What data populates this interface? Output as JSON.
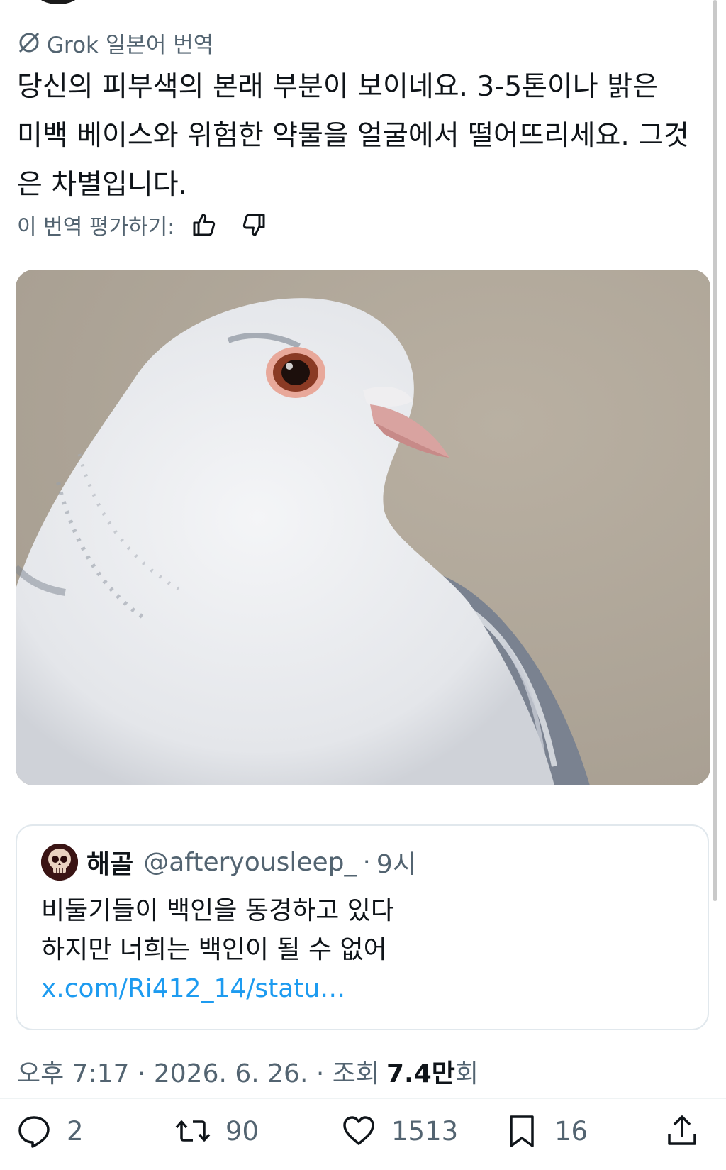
{
  "grok": {
    "label": "Grok 일본어 번역",
    "icon": "grok-logo-icon"
  },
  "tweet": {
    "translated_text": "당신의 피부색의 본래 부분이 보이네요. 3-5톤이나 밝은 미백 베이스와 위험한 약물을 얼굴에서 떨어뜨리세요. 그것은 차별입니다."
  },
  "rating": {
    "label": "이 번역 평가하기:",
    "up_icon": "thumbs-up-icon",
    "down_icon": "thumbs-down-icon"
  },
  "media": {
    "icon": "white-pigeon-photo"
  },
  "quote": {
    "avatar_icon": "skull-avatar-icon",
    "name": "해골",
    "handle": "@afteryousleep_",
    "separator": "·",
    "time": "9시",
    "line1": "비둘기들이 백인을 동경하고 있다",
    "line2": "하지만 너희는 백인이 될 수 없어",
    "link": "x.com/Ri412_14/statu…"
  },
  "meta": {
    "time": "오후 7:17 · 2026. 6. 26. · 조회",
    "views": "7.4만",
    "views_suffix": "회"
  },
  "actions": {
    "reply": {
      "icon": "reply-icon",
      "count": "2"
    },
    "repost": {
      "icon": "repost-icon",
      "count": "90"
    },
    "like": {
      "icon": "heart-icon",
      "count": "1513"
    },
    "bookmark": {
      "icon": "bookmark-icon",
      "count": "16"
    },
    "share": {
      "icon": "share-icon"
    }
  },
  "colors": {
    "text": "#0f1419",
    "secondary": "#536471",
    "link": "#1d9bf0",
    "border": "#e1e8ed"
  }
}
